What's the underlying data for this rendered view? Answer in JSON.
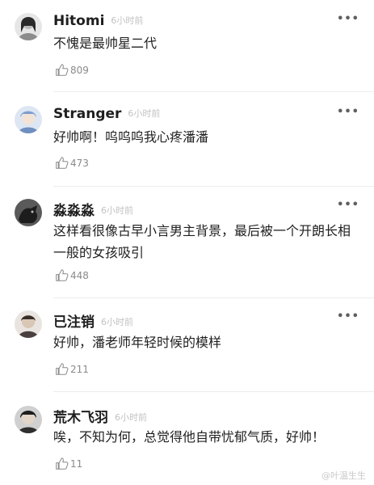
{
  "comments": [
    {
      "name": "Hitomi",
      "time": "6小时前",
      "text": "不愧是最帅星二代",
      "likes": "809",
      "avatar_color": "#c7c7c7"
    },
    {
      "name": "Stranger",
      "time": "6小时前",
      "text": "好帅啊！呜呜呜我心疼潘潘",
      "likes": "473",
      "avatar_color": "#9fb6d8"
    },
    {
      "name": "淼淼淼",
      "time": "6小时前",
      "text": "这样看很像古早小言男主背景，最后被一个开朗长相一般的女孩吸引",
      "likes": "448",
      "avatar_color": "#3e3e3e"
    },
    {
      "name": "已注销",
      "time": "6小时前",
      "text": "好帅，潘老师年轻时候的模样",
      "likes": "211",
      "avatar_color": "#7d6d62"
    },
    {
      "name": "荒木飞羽",
      "time": "6小时前",
      "text": "唉，不知为何，总觉得他自带忧郁气质，好帅！",
      "likes": "11",
      "avatar_color": "#4a4a4a"
    }
  ],
  "more_label": "•••",
  "watermark": "@叶温生生"
}
